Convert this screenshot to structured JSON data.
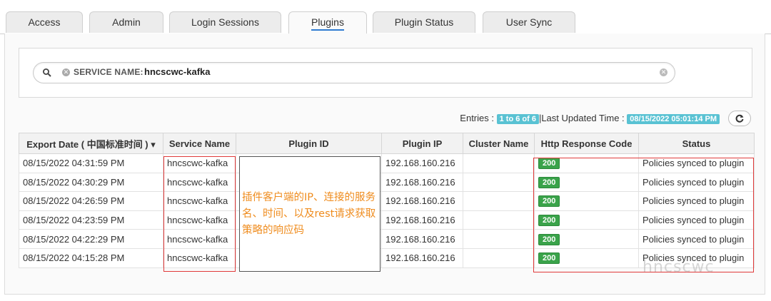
{
  "tabs": [
    {
      "label": "Access"
    },
    {
      "label": "Admin"
    },
    {
      "label": "Login Sessions"
    },
    {
      "label": "Plugins"
    },
    {
      "label": "Plugin Status"
    },
    {
      "label": "User Sync"
    }
  ],
  "search": {
    "filter_key": "SERVICE NAME:",
    "filter_value": "hncscwc-kafka"
  },
  "summary": {
    "entries_label": "Entries :",
    "entries_value": "1 to 6 of 6",
    "last_updated_label": "|Last Updated Time :",
    "last_updated_value": "08/15/2022 05:01:14 PM"
  },
  "table": {
    "headers": [
      "Export Date ( 中国标准时间 )",
      "Service Name",
      "Plugin ID",
      "Plugin IP",
      "Cluster Name",
      "Http Response Code",
      "Status"
    ],
    "rows": [
      {
        "export_date": "08/15/2022 04:31:59 PM",
        "service": "hncscwc-kafka",
        "plugin_id": "",
        "ip": "192.168.160.216",
        "cluster": "",
        "code": "200",
        "status": "Policies synced to plugin"
      },
      {
        "export_date": "08/15/2022 04:30:29 PM",
        "service": "hncscwc-kafka",
        "plugin_id": "",
        "ip": "192.168.160.216",
        "cluster": "",
        "code": "200",
        "status": "Policies synced to plugin"
      },
      {
        "export_date": "08/15/2022 04:26:59 PM",
        "service": "hncscwc-kafka",
        "plugin_id": "",
        "ip": "192.168.160.216",
        "cluster": "",
        "code": "200",
        "status": "Policies synced to plugin"
      },
      {
        "export_date": "08/15/2022 04:23:59 PM",
        "service": "hncscwc-kafka",
        "plugin_id": "",
        "ip": "192.168.160.216",
        "cluster": "",
        "code": "200",
        "status": "Policies synced to plugin"
      },
      {
        "export_date": "08/15/2022 04:22:29 PM",
        "service": "hncscwc-kafka",
        "plugin_id": "",
        "ip": "192.168.160.216",
        "cluster": "",
        "code": "200",
        "status": "Policies synced to plugin"
      },
      {
        "export_date": "08/15/2022 04:15:28 PM",
        "service": "hncscwc-kafka",
        "plugin_id": "",
        "ip": "192.168.160.216",
        "cluster": "",
        "code": "200",
        "status": "Policies synced to plugin"
      }
    ]
  },
  "annotation": {
    "text": "插件客户端的IP、连接的服务名、时间、以及rest请求获取策略的响应码"
  },
  "watermark": "hncscwc",
  "colors": {
    "highlight_border": "#e03a3a",
    "badge_blue": "#59c2d3",
    "code_green": "#3aa34a",
    "annotation_orange": "#ef8c1e",
    "active_tab_underline": "#2f7bd1"
  },
  "icons": {
    "search": "search-icon",
    "remove_filter": "close-circle-icon",
    "clear_search": "close-circle-icon",
    "refresh": "refresh-icon",
    "sort": "caret-down-icon"
  }
}
